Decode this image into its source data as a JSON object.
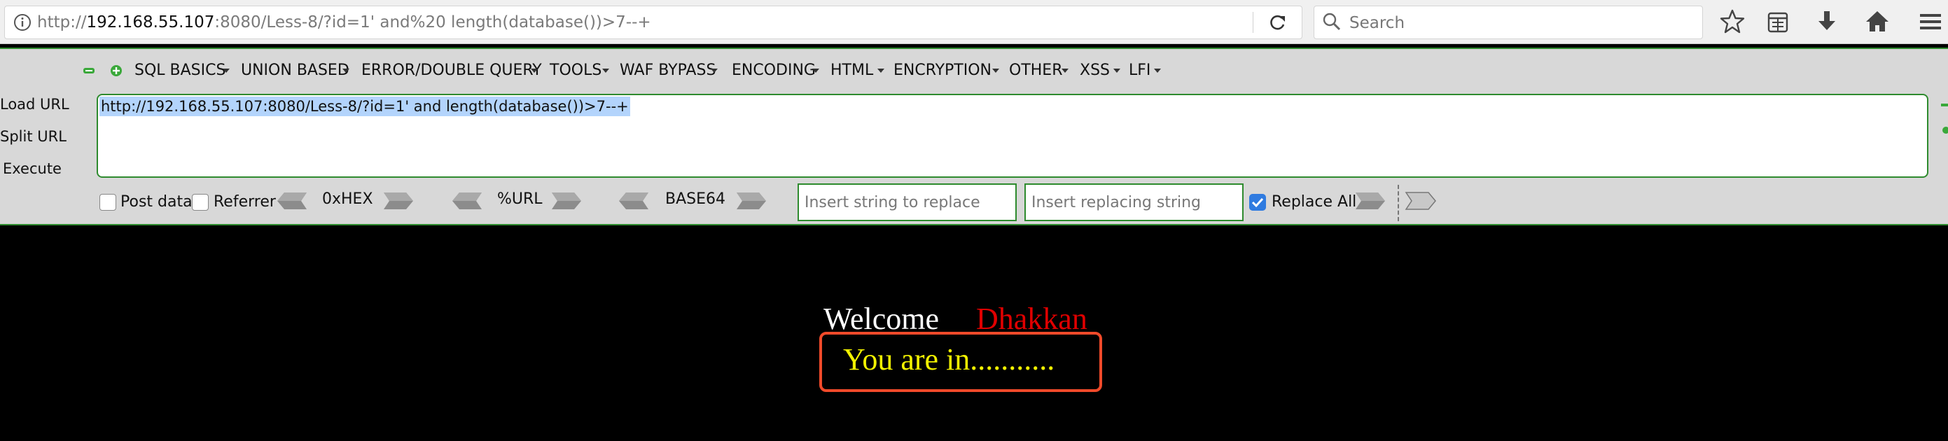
{
  "browser": {
    "url_prefix": "http://",
    "url_host": "192.168.55.107",
    "url_rest": ":8080/Less-8/?id=1' and%20 length(database())>7--+",
    "search_placeholder": "Search"
  },
  "hackbar": {
    "menu": [
      {
        "label": "SQL BASICS"
      },
      {
        "label": "UNION BASED"
      },
      {
        "label": "ERROR/DOUBLE QUERY"
      },
      {
        "label": "TOOLS"
      },
      {
        "label": "WAF BYPASS"
      },
      {
        "label": "ENCODING"
      },
      {
        "label": "HTML"
      },
      {
        "label": "ENCRYPTION"
      },
      {
        "label": "OTHER"
      },
      {
        "label": "XSS"
      },
      {
        "label": "LFI"
      }
    ],
    "actions": {
      "load": "Load URL",
      "split": "Split URL",
      "execute": "Execute"
    },
    "url_value": "http://192.168.55.107:8080/Less-8/?id=1' and  length(database())>7--+",
    "post_data_label": "Post data",
    "referrer_label": "Referrer",
    "hex_label": "0xHEX",
    "url_enc_label": "%URL",
    "base64_label": "BASE64",
    "replace_placeholder": "Insert string to replace",
    "replacing_placeholder": "Insert replacing string",
    "replace_all_label": "Replace All",
    "replace_all_checked": true,
    "accent_color": "#2e8b2e"
  },
  "page": {
    "welcome": "Welcome",
    "username": "Dhakkan",
    "message": "You are in...........",
    "background": "#000000",
    "message_color": "#f2f200",
    "username_color": "#e00000",
    "box_border_color": "#f04a2a"
  }
}
